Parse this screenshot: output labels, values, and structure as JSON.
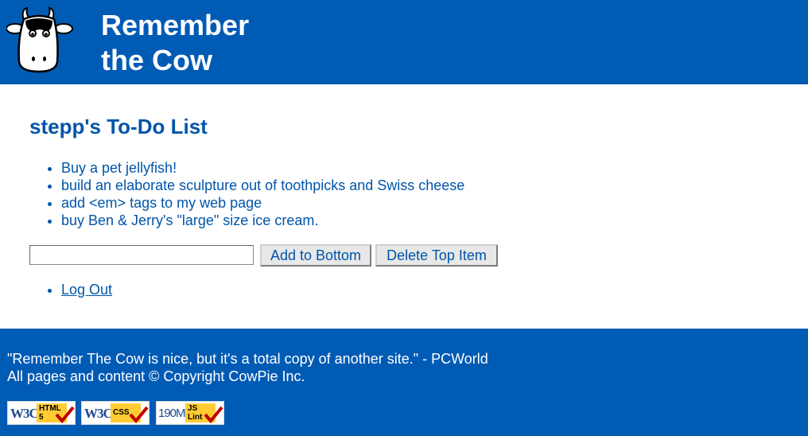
{
  "header": {
    "logo_icon": "cow-head-icon",
    "title_line1": "Remember",
    "title_line2": "the Cow",
    "background": "#005bb5"
  },
  "main": {
    "page_title": "stepp's To-Do List",
    "items": [
      "Buy a pet jellyfish!",
      "build an elaborate sculpture out of toothpicks and Swiss cheese",
      "add <em> tags to my web page",
      "buy Ben & Jerry's \"large\" size ice cream."
    ],
    "new_item_value": "",
    "add_button": "Add to Bottom",
    "delete_button": "Delete Top Item",
    "logout_link": "Log Out"
  },
  "footer": {
    "quote": "\"Remember The Cow is nice, but it's a total copy of another site.\" - PCWorld",
    "copyright": "All pages and content © Copyright CowPie Inc.",
    "badges": [
      {
        "left": "W3C",
        "tag_line1": "HTML",
        "tag_line2": "5"
      },
      {
        "left": "W3C",
        "tag_line1": "CSS",
        "tag_line2": ""
      },
      {
        "left": "190M",
        "tag_line1": "JS",
        "tag_line2": "Lint"
      }
    ]
  },
  "colors": {
    "brand_blue": "#005bb5",
    "text_blue": "#0055aa",
    "badge_yellow": "#ffcc33",
    "check_red": "#c00000"
  }
}
